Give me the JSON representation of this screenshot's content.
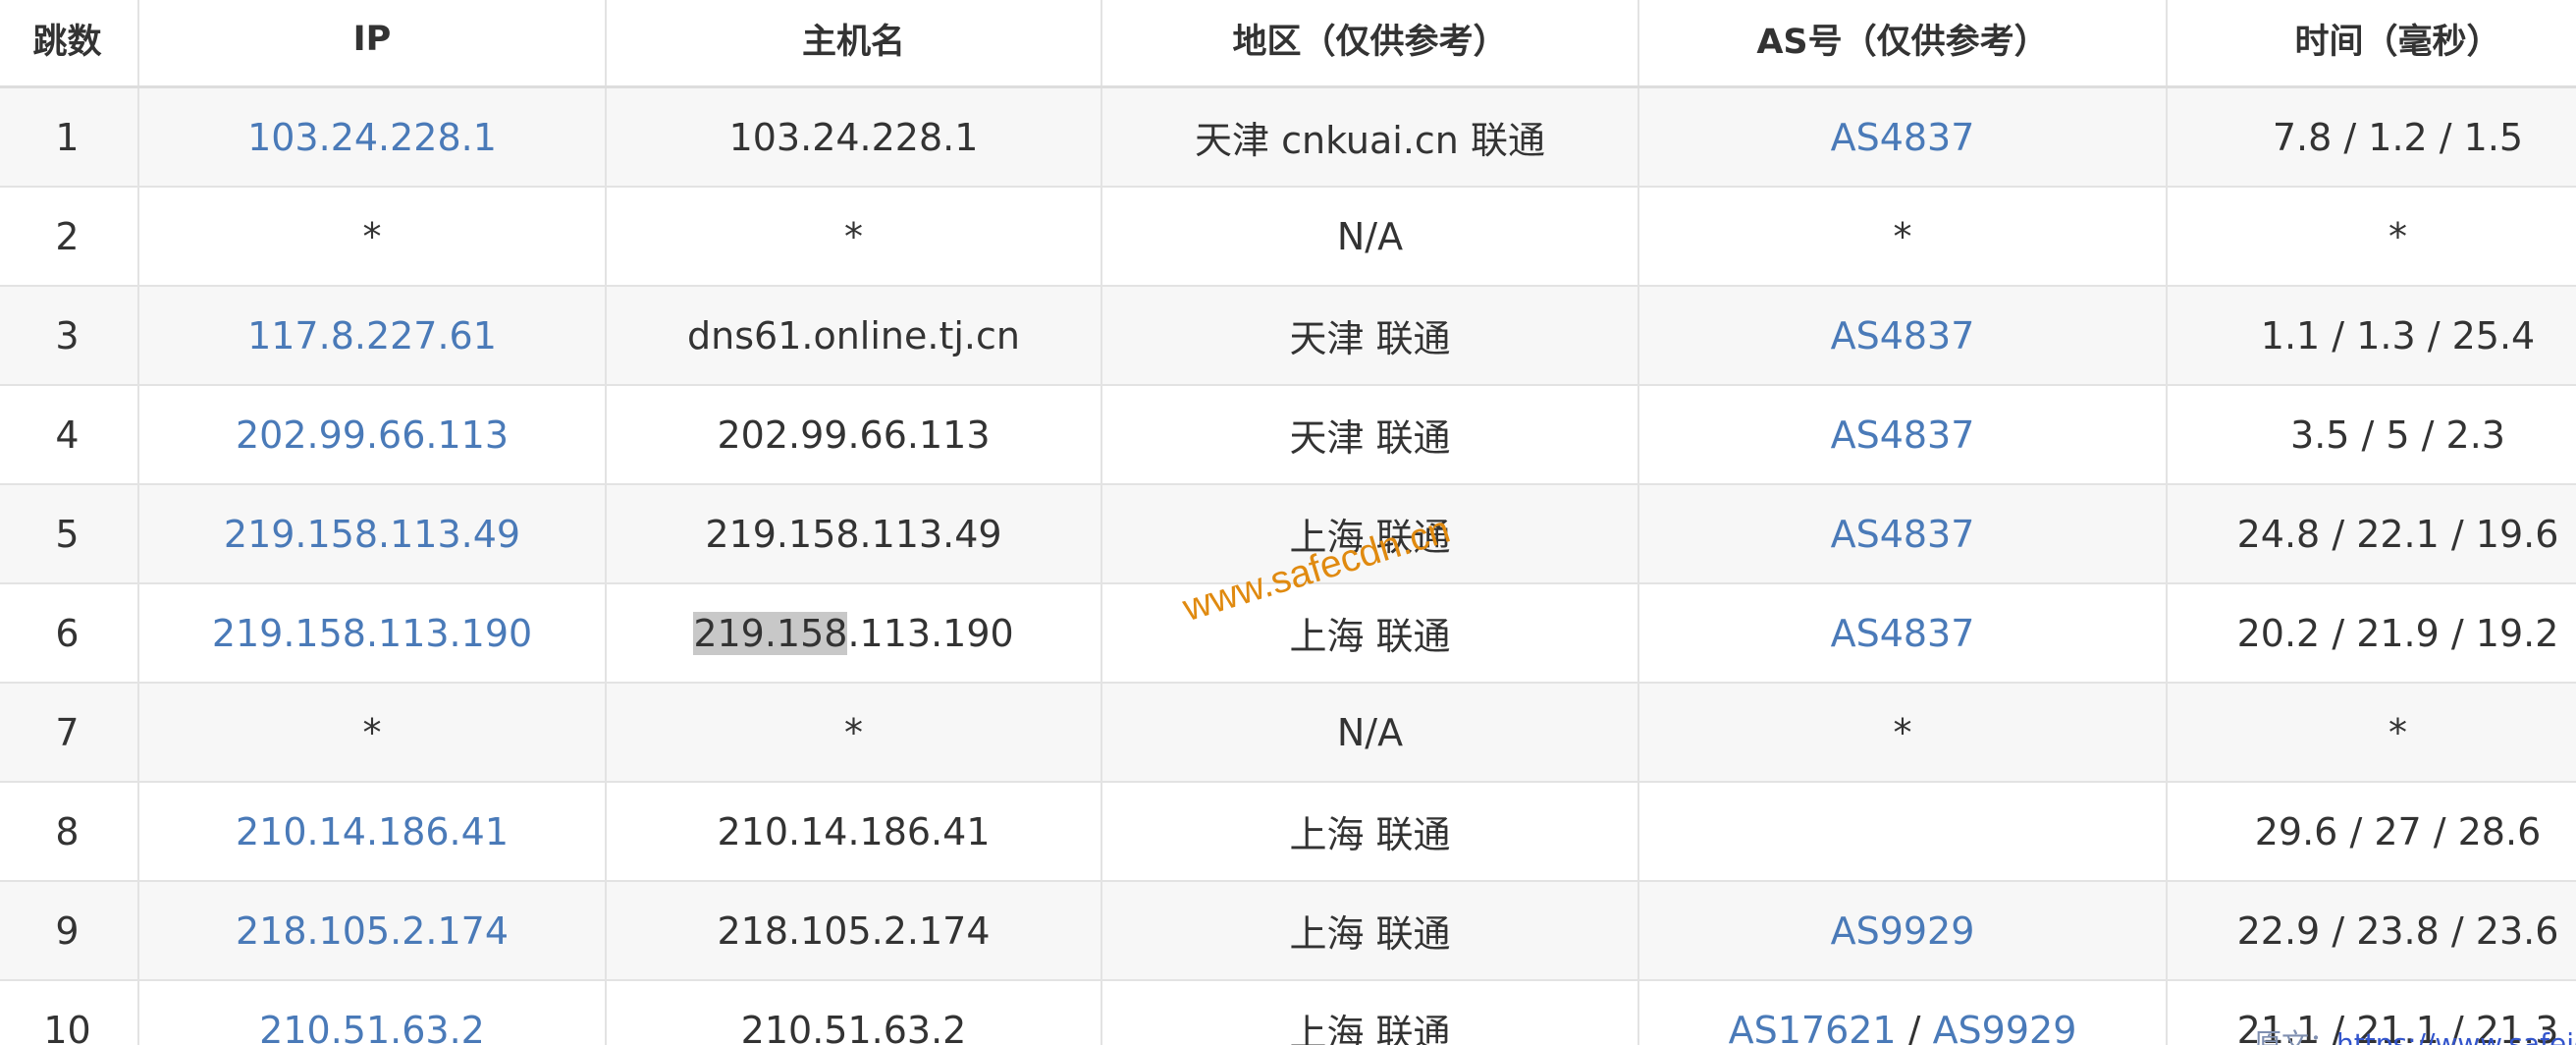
{
  "table": {
    "headers": {
      "hop": "跳数",
      "ip": "IP",
      "hostname": "主机名",
      "region": "地区（仅供参考）",
      "asn": "AS号（仅供参考）",
      "time": "时间（毫秒）"
    },
    "rows": [
      {
        "hop": "1",
        "ip": "103.24.228.1",
        "hostname": "103.24.228.1",
        "region": "天津 cnkuai.cn 联通",
        "asn": [
          "AS4837"
        ],
        "time": "7.8 / 1.2 / 1.5"
      },
      {
        "hop": "2",
        "ip": "*",
        "hostname": "*",
        "region": "N/A",
        "asn_text": "*",
        "time": "*"
      },
      {
        "hop": "3",
        "ip": "117.8.227.61",
        "hostname": "dns61.online.tj.cn",
        "region": "天津 联通",
        "asn": [
          "AS4837"
        ],
        "time": "1.1 / 1.3 / 25.4"
      },
      {
        "hop": "4",
        "ip": "202.99.66.113",
        "hostname": "202.99.66.113",
        "region": "天津 联通",
        "asn": [
          "AS4837"
        ],
        "time": "3.5 / 5 / 2.3"
      },
      {
        "hop": "5",
        "ip": "219.158.113.49",
        "hostname": "219.158.113.49",
        "region": "上海 联通",
        "asn": [
          "AS4837"
        ],
        "time": "24.8 / 22.1 / 19.6"
      },
      {
        "hop": "6",
        "ip": "219.158.113.190",
        "hostname_selected": "219.158",
        "hostname_rest": ".113.190",
        "region": "上海 联通",
        "asn": [
          "AS4837"
        ],
        "time": "20.2 / 21.9 / 19.2"
      },
      {
        "hop": "7",
        "ip": "*",
        "hostname": "*",
        "region": "N/A",
        "asn_text": "*",
        "time": "*"
      },
      {
        "hop": "8",
        "ip": "210.14.186.41",
        "hostname": "210.14.186.41",
        "region": "上海 联通",
        "asn": [],
        "time": "29.6 / 27 / 28.6"
      },
      {
        "hop": "9",
        "ip": "218.105.2.174",
        "hostname": "218.105.2.174",
        "region": "上海 联通",
        "asn": [
          "AS9929"
        ],
        "time": "22.9 / 23.8 / 23.6"
      },
      {
        "hop": "10",
        "ip": "210.51.63.2",
        "hostname": "210.51.63.2",
        "region": "上海 联通",
        "asn": [
          "AS17621",
          "AS9929"
        ],
        "asn_separator": " / ",
        "time": "21.1 / 21.1 / 21.3"
      }
    ]
  },
  "watermark": "www.safecdn.cn",
  "footer": {
    "prefix": "原文：",
    "link": "https://www.safeidc.cn"
  },
  "colors": {
    "link": "#4a7ab8",
    "text": "#333333",
    "row_stripe": "#f7f7f7",
    "watermark": "#e08a10",
    "selection": "#c8c8c8"
  }
}
